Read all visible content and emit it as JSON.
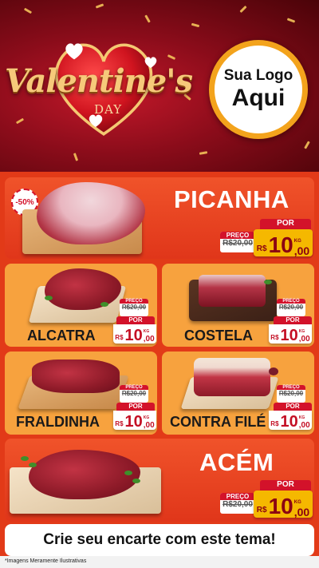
{
  "header": {
    "title": "Valentine's",
    "subtitle": "DAY",
    "logo": {
      "line1": "Sua Logo",
      "line2": "Aqui"
    }
  },
  "products": [
    {
      "name": "PICANHA",
      "badge": "-50%",
      "old_label": "PREÇO",
      "old_price": "R$20,00",
      "por_label": "POR",
      "currency": "R$",
      "price_int": "10",
      "price_dec": ",00",
      "unit": "KG"
    },
    {
      "name": "ALCATRA",
      "old_label": "PREÇO",
      "old_price": "R$20,00",
      "por_label": "POR",
      "currency": "R$",
      "price_int": "10",
      "price_dec": ",00",
      "unit": "KG"
    },
    {
      "name": "COSTELA",
      "old_label": "PREÇO",
      "old_price": "R$20,00",
      "por_label": "POR",
      "currency": "R$",
      "price_int": "10",
      "price_dec": ",00",
      "unit": "KG"
    },
    {
      "name": "FRALDINHA",
      "old_label": "PREÇO",
      "old_price": "R$20,00",
      "por_label": "POR",
      "currency": "R$",
      "price_int": "10",
      "price_dec": ",00",
      "unit": "KG"
    },
    {
      "name": "CONTRA FILÉ",
      "old_label": "PREÇO",
      "old_price": "R$20,00",
      "por_label": "POR",
      "currency": "R$",
      "price_int": "10",
      "price_dec": ",00",
      "unit": "KG"
    },
    {
      "name": "ACÉM",
      "old_label": "PREÇO",
      "old_price": "R$20,00",
      "por_label": "POR",
      "currency": "R$",
      "price_int": "10",
      "price_dec": ",00",
      "unit": "KG"
    }
  ],
  "footer": {
    "cta": "Crie seu encarte com este tema!",
    "disclaimer": "*Imagens Meramente Ilustrativas"
  },
  "colors": {
    "red": "#d3122a",
    "orange": "#f7a23e",
    "gold": "#f5b800"
  }
}
